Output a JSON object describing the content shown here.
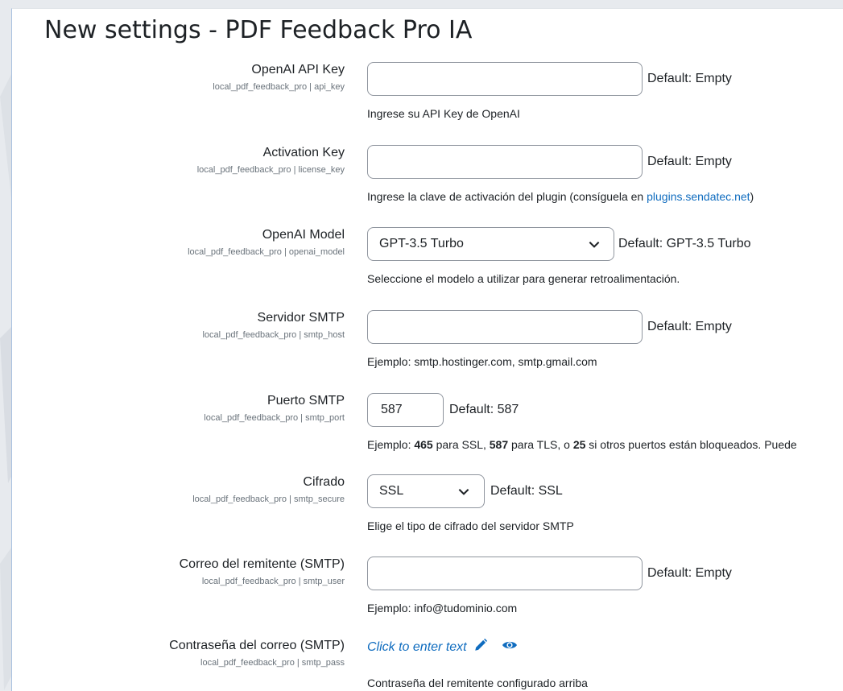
{
  "page": {
    "title": "New settings - PDF Feedback Pro IA"
  },
  "settings": [
    {
      "label": "OpenAI API Key",
      "id": "local_pdf_feedback_pro | api_key",
      "value": "",
      "default": "Default: Empty",
      "description": "Ingrese su API Key de OpenAI"
    },
    {
      "label": "Activation Key",
      "id": "local_pdf_feedback_pro | license_key",
      "value": "",
      "default": "Default: Empty",
      "description_prefix": "Ingrese la clave de activación del plugin (consíguela en ",
      "description_link": "plugins.sendatec.net",
      "description_suffix": ")"
    },
    {
      "label": "OpenAI Model",
      "id": "local_pdf_feedback_pro | openai_model",
      "selected": "GPT-3.5 Turbo",
      "default": "Default: GPT-3.5 Turbo",
      "description": "Seleccione el modelo a utilizar para generar retroalimentación."
    },
    {
      "label": "Servidor SMTP",
      "id": "local_pdf_feedback_pro | smtp_host",
      "value": "",
      "default": "Default: Empty",
      "description": "Ejemplo: smtp.hostinger.com, smtp.gmail.com"
    },
    {
      "label": "Puerto SMTP",
      "id": "local_pdf_feedback_pro | smtp_port",
      "value": "587",
      "default": "Default: 587",
      "desc_parts": [
        "Ejemplo: ",
        "465",
        " para SSL, ",
        "587",
        " para TLS, o ",
        "25",
        " si otros puertos están bloqueados. Puede"
      ]
    },
    {
      "label": "Cifrado",
      "id": "local_pdf_feedback_pro | smtp_secure",
      "selected": "SSL",
      "default": "Default: SSL",
      "description": "Elige el tipo de cifrado del servidor SMTP"
    },
    {
      "label": "Correo del remitente (SMTP)",
      "id": "local_pdf_feedback_pro | smtp_user",
      "value": "",
      "default": "Default: Empty",
      "description": "Ejemplo: info@tudominio.com"
    },
    {
      "label": "Contraseña del correo (SMTP)",
      "id": "local_pdf_feedback_pro | smtp_pass",
      "click_text": "Click to enter text",
      "description": "Contraseña del remitente configurado arriba"
    }
  ],
  "icons": {
    "edit": "pencil-icon",
    "reveal": "eye-icon",
    "dropdown": "chevron-down-icon"
  },
  "colors": {
    "link": "#0f6cbf",
    "text": "#1d2125",
    "muted": "#6a737b",
    "border": "#8f959e"
  }
}
